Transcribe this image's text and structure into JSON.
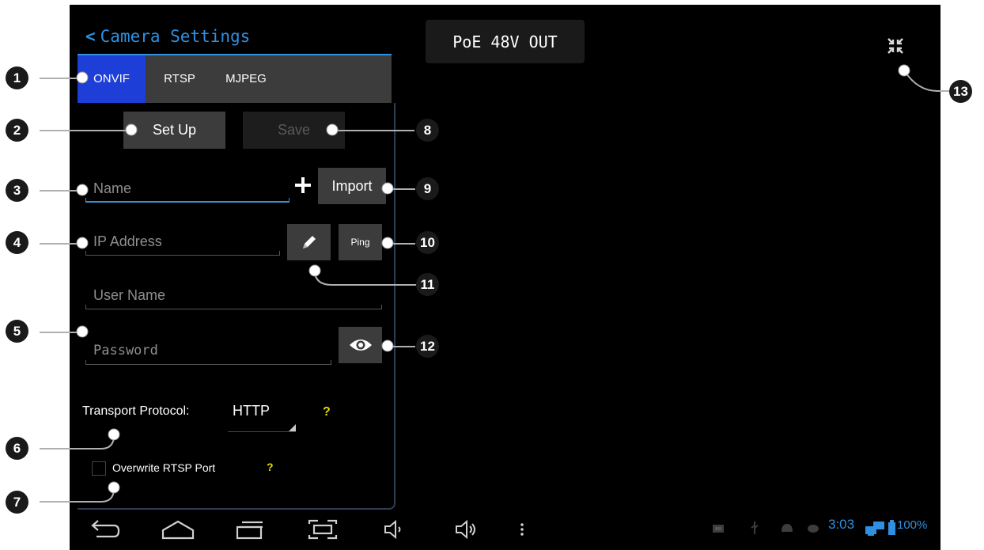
{
  "header": {
    "title": "Camera Settings",
    "poe_status": "PoE 48V OUT"
  },
  "tabs": [
    {
      "label": "ONVIF",
      "active": true
    },
    {
      "label": "RTSP",
      "active": false
    },
    {
      "label": "MJPEG",
      "active": false
    }
  ],
  "buttons": {
    "setup": "Set Up",
    "save": "Save",
    "import": "Import",
    "ping": "Ping"
  },
  "fields": {
    "name_placeholder": "Name",
    "ip_placeholder": "IP Address",
    "username_placeholder": "User Name",
    "password_placeholder": "Password"
  },
  "transport": {
    "label": "Transport Protocol:",
    "value": "HTTP",
    "help": "?"
  },
  "rtsp_port": {
    "label": "Overwrite RTSP Port",
    "help": "?",
    "checked": false
  },
  "status_bar": {
    "time": "3:03",
    "battery": "100%"
  },
  "callouts": [
    "1",
    "2",
    "3",
    "4",
    "5",
    "6",
    "7",
    "8",
    "9",
    "10",
    "11",
    "12",
    "13"
  ],
  "colors": {
    "accent": "#2f8fe0",
    "active_tab": "#1e3ed8",
    "help": "#e8d800",
    "background": "#000000"
  }
}
